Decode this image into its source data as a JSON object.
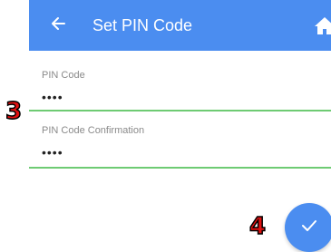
{
  "appbar": {
    "title": "Set PIN Code",
    "back_icon": "arrow-left-icon",
    "home_icon": "home-icon",
    "color": "#4b8df0"
  },
  "form": {
    "pin": {
      "label": "PIN Code",
      "value": "••••"
    },
    "confirm": {
      "label": "PIN Code Confirmation",
      "value": "••••"
    },
    "underline_color": "#6ecb73"
  },
  "annotations": {
    "fields_marker": "3",
    "fab_marker": "4",
    "color": "#e01010"
  },
  "fab": {
    "icon": "check-icon",
    "color": "#4b8df0"
  }
}
